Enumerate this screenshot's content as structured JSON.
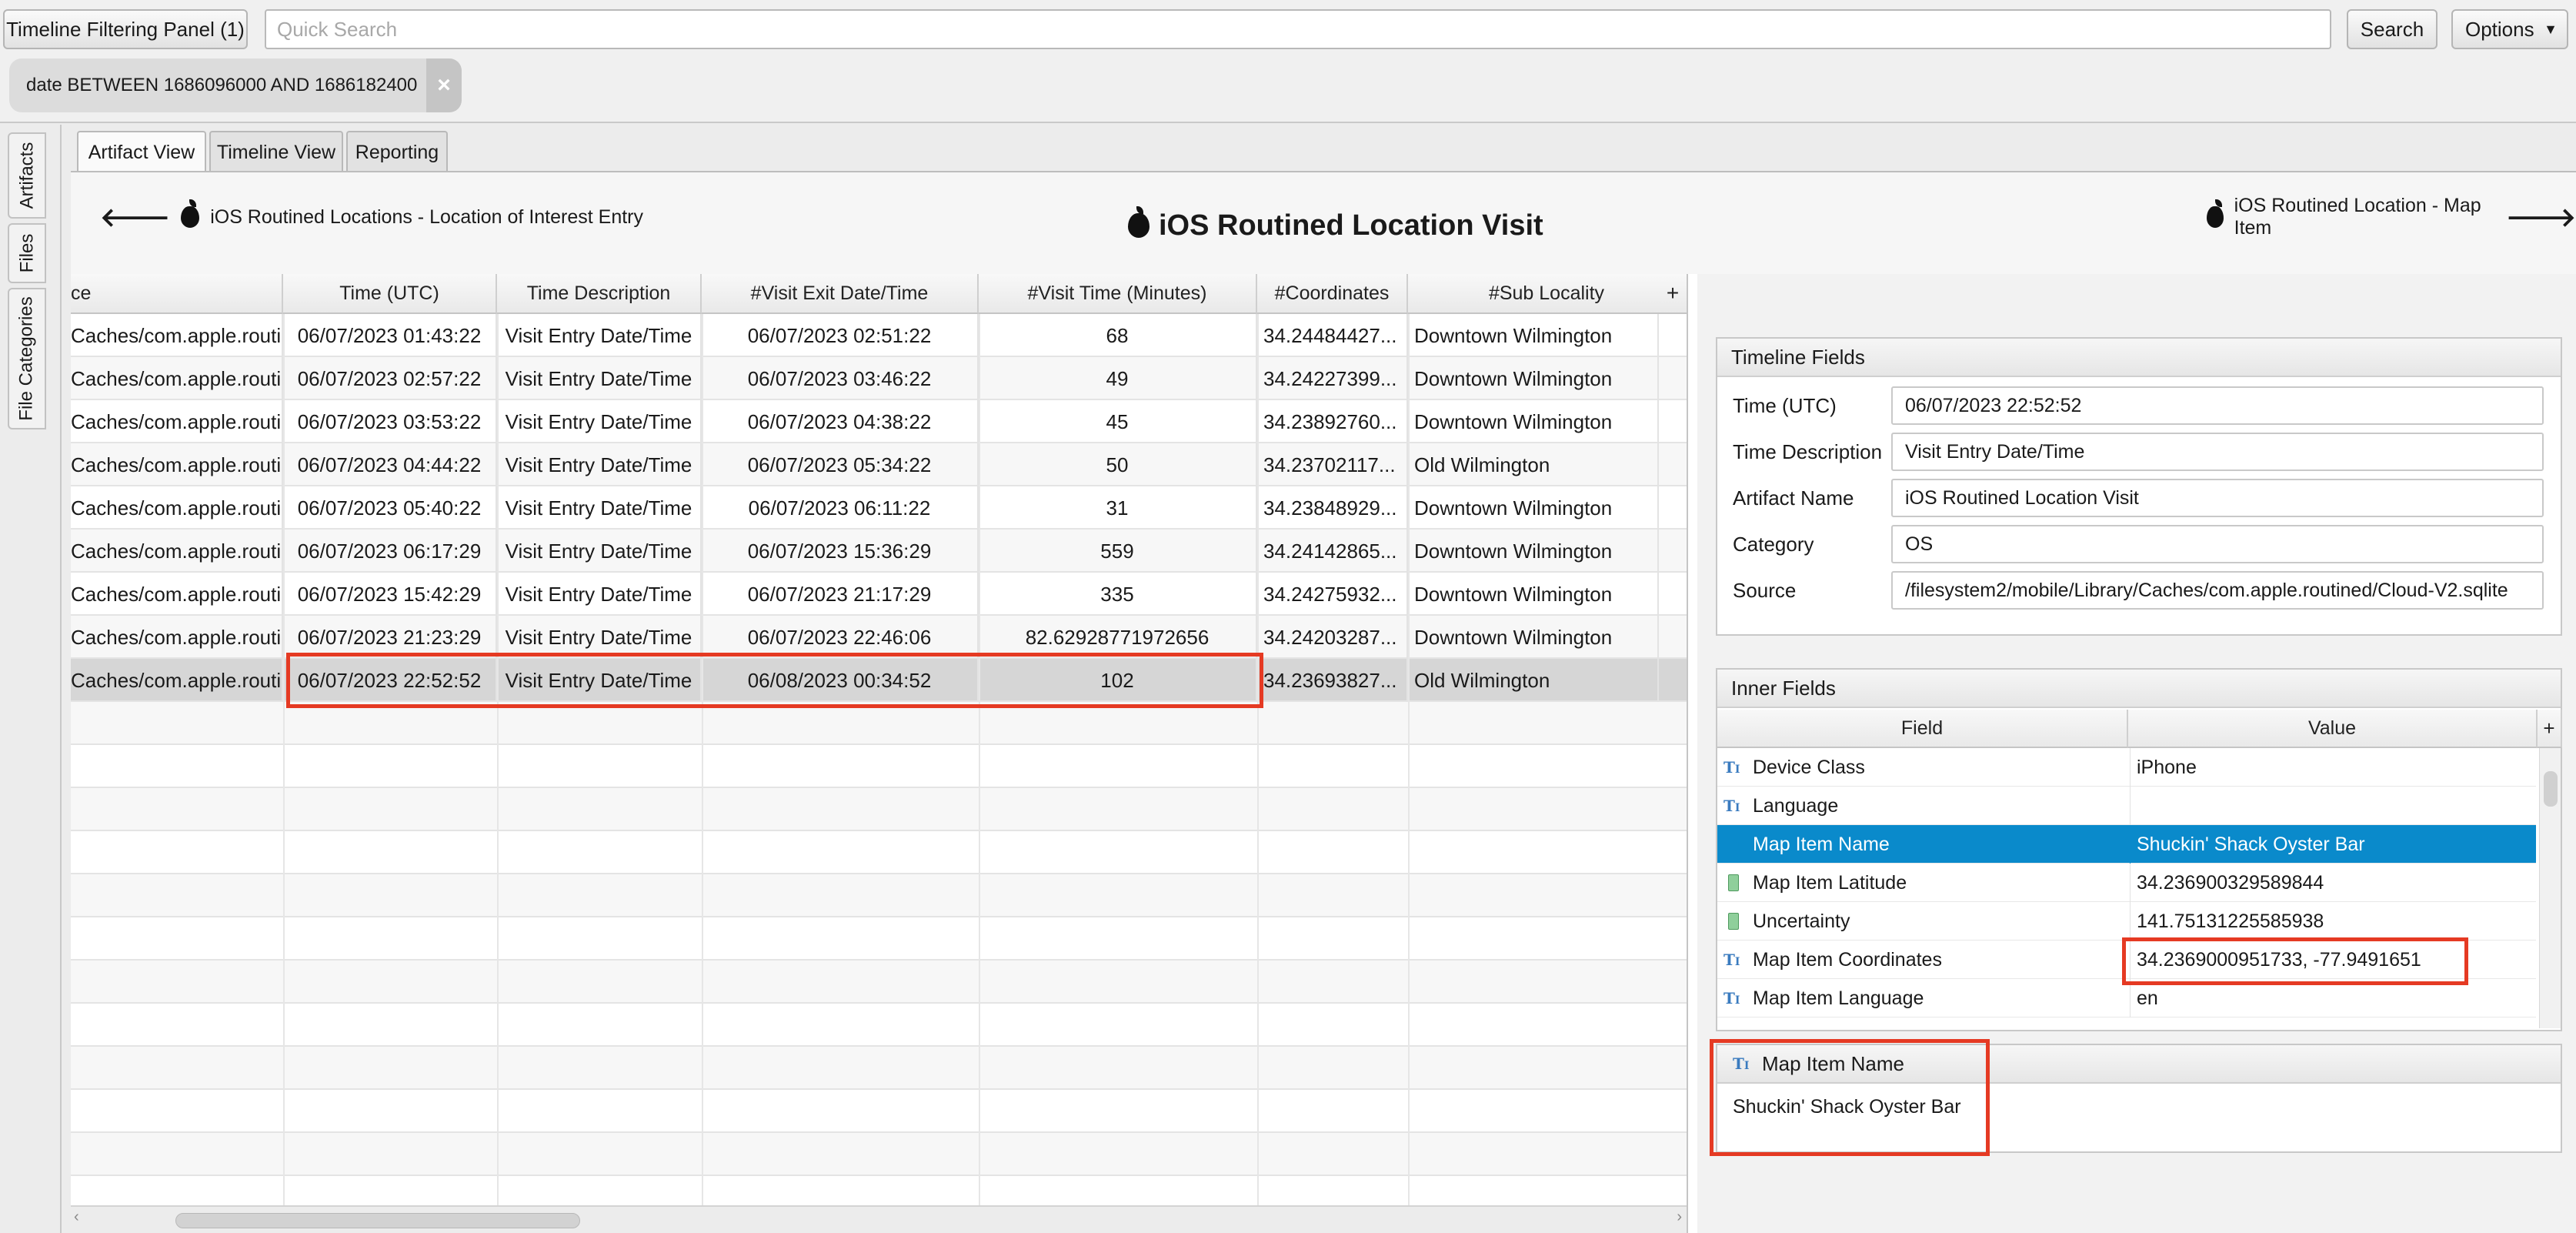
{
  "toolbar": {
    "filter_panel_label": "Timeline Filtering Panel (1)",
    "search_placeholder": "Quick Search",
    "search_button": "Search",
    "options_button": "Options",
    "filter_chip": "date BETWEEN 1686096000 AND 1686182400"
  },
  "side_tabs": [
    "Artifacts",
    "Files",
    "File Categories"
  ],
  "tabs": [
    "Artifact View",
    "Timeline View",
    "Reporting"
  ],
  "header": {
    "prev_label": "iOS Routined Locations - Location of Interest Entry",
    "title": "iOS Routined Location Visit",
    "next_label": "iOS Routined Location - Map Item"
  },
  "table": {
    "columns": [
      "ce",
      "Time (UTC)",
      "Time Description",
      "#Visit Exit Date/Time",
      "#Visit Time (Minutes)",
      "#Coordinates",
      "#Sub Locality"
    ],
    "rows": [
      [
        "Caches/com.apple.routi...",
        "06/07/2023 01:43:22",
        "Visit Entry Date/Time",
        "06/07/2023 02:51:22",
        "68",
        "34.24484427...",
        "Downtown Wilmington"
      ],
      [
        "Caches/com.apple.routi...",
        "06/07/2023 02:57:22",
        "Visit Entry Date/Time",
        "06/07/2023 03:46:22",
        "49",
        "34.24227399...",
        "Downtown Wilmington"
      ],
      [
        "Caches/com.apple.routi...",
        "06/07/2023 03:53:22",
        "Visit Entry Date/Time",
        "06/07/2023 04:38:22",
        "45",
        "34.23892760...",
        "Downtown Wilmington"
      ],
      [
        "Caches/com.apple.routi...",
        "06/07/2023 04:44:22",
        "Visit Entry Date/Time",
        "06/07/2023 05:34:22",
        "50",
        "34.23702117...",
        "Old Wilmington"
      ],
      [
        "Caches/com.apple.routi...",
        "06/07/2023 05:40:22",
        "Visit Entry Date/Time",
        "06/07/2023 06:11:22",
        "31",
        "34.23848929...",
        "Downtown Wilmington"
      ],
      [
        "Caches/com.apple.routi...",
        "06/07/2023 06:17:29",
        "Visit Entry Date/Time",
        "06/07/2023 15:36:29",
        "559",
        "34.24142865...",
        "Downtown Wilmington"
      ],
      [
        "Caches/com.apple.routi...",
        "06/07/2023 15:42:29",
        "Visit Entry Date/Time",
        "06/07/2023 21:17:29",
        "335",
        "34.24275932...",
        "Downtown Wilmington"
      ],
      [
        "Caches/com.apple.routi...",
        "06/07/2023 21:23:29",
        "Visit Entry Date/Time",
        "06/07/2023 22:46:06",
        "82.62928771972656",
        "34.24203287...",
        "Downtown Wilmington"
      ],
      [
        "Caches/com.apple.routi...",
        "06/07/2023 22:52:52",
        "Visit Entry Date/Time",
        "06/08/2023 00:34:52",
        "102",
        "34.23693827...",
        "Old Wilmington"
      ]
    ]
  },
  "timeline_fields": {
    "title": "Timeline Fields",
    "fields": [
      {
        "label": "Time (UTC)",
        "value": "06/07/2023 22:52:52"
      },
      {
        "label": "Time Description",
        "value": "Visit Entry Date/Time"
      },
      {
        "label": "Artifact Name",
        "value": "iOS Routined Location Visit"
      },
      {
        "label": "Category",
        "value": "OS"
      },
      {
        "label": "Source",
        "value": "/filesystem2/mobile/Library/Caches/com.apple.routined/Cloud-V2.sqlite"
      }
    ]
  },
  "inner_fields": {
    "title": "Inner Fields",
    "columns": [
      "Field",
      "Value"
    ],
    "rows": [
      {
        "icon": "text-icon",
        "field": "Device Class",
        "value": "iPhone"
      },
      {
        "icon": "text-icon",
        "field": "Language",
        "value": ""
      },
      {
        "icon": "text-icon",
        "field": "Map Item Name",
        "value": "Shuckin' Shack Oyster Bar"
      },
      {
        "icon": "number-icon",
        "field": "Map Item Latitude",
        "value": "34.236900329589844"
      },
      {
        "icon": "number-icon",
        "field": "Uncertainty",
        "value": "141.75131225585938"
      },
      {
        "icon": "text-icon",
        "field": "Map Item Coordinates",
        "value": "34.2369000951733, -77.9491651"
      },
      {
        "icon": "text-icon",
        "field": "Map Item Language",
        "value": "en"
      }
    ]
  },
  "detail": {
    "title": "Map Item Name",
    "value": "Shuckin' Shack Oyster Bar"
  },
  "colors": {
    "highlight_box": "#e53a23",
    "selected_row": "#0a8acb"
  }
}
